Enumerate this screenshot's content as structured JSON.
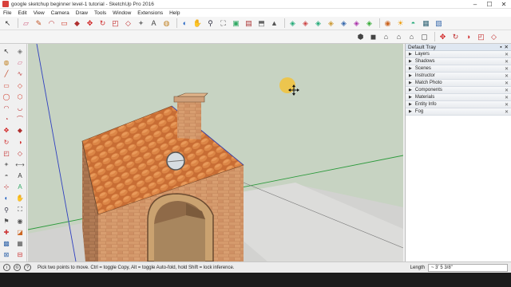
{
  "window": {
    "title": "google sketchup beginner level-1  tutorial - SketchUp Pro 2016",
    "minimize": "–",
    "maximize": "☐",
    "close": "✕"
  },
  "menu": [
    "File",
    "Edit",
    "View",
    "Camera",
    "Draw",
    "Tools",
    "Window",
    "Extensions",
    "Help"
  ],
  "toolbar_main": [
    {
      "name": "select-icon",
      "glyph": "↖",
      "color": "#333"
    },
    {
      "name": "eraser-icon",
      "glyph": "▱",
      "color": "#d06080"
    },
    {
      "name": "pencil-icon",
      "glyph": "✎",
      "color": "#c05020"
    },
    {
      "name": "arc-icon",
      "glyph": "◠",
      "color": "#c04040"
    },
    {
      "name": "shape-icon",
      "glyph": "▭",
      "color": "#d04030"
    },
    {
      "name": "pushpull-icon",
      "glyph": "◆",
      "color": "#b03030"
    },
    {
      "name": "move-icon",
      "glyph": "✥",
      "color": "#d02020"
    },
    {
      "name": "rotate-icon",
      "glyph": "↻",
      "color": "#d03030"
    },
    {
      "name": "scale-icon",
      "glyph": "◰",
      "color": "#c02020"
    },
    {
      "name": "offset-icon",
      "glyph": "◇",
      "color": "#c03030"
    },
    {
      "name": "tape-icon",
      "glyph": "✦",
      "color": "#777"
    },
    {
      "name": "text-icon",
      "glyph": "A",
      "color": "#444"
    },
    {
      "name": "paint-icon",
      "glyph": "◍",
      "color": "#c08020"
    },
    {
      "name": "orbit-icon",
      "glyph": "◐",
      "color": "#2060c0"
    },
    {
      "name": "pan-icon",
      "glyph": "✋",
      "color": "#aa7744"
    },
    {
      "name": "zoom-icon",
      "glyph": "⚲",
      "color": "#334"
    },
    {
      "name": "zoom-extents-icon",
      "glyph": "⛶",
      "color": "#333"
    },
    {
      "name": "warehouse-icon",
      "glyph": "▣",
      "color": "#3a6"
    },
    {
      "name": "extension-icon",
      "glyph": "▤",
      "color": "#a33"
    },
    {
      "name": "share-icon",
      "glyph": "⬒",
      "color": "#666"
    },
    {
      "name": "send-icon",
      "glyph": "▲",
      "color": "#555"
    },
    {
      "name": "sandbox1-icon",
      "glyph": "◈",
      "color": "#2a7"
    },
    {
      "name": "sandbox2-icon",
      "glyph": "◈",
      "color": "#c44"
    },
    {
      "name": "sandbox3-icon",
      "glyph": "◈",
      "color": "#2a7"
    },
    {
      "name": "sandbox4-icon",
      "glyph": "◈",
      "color": "#c93"
    },
    {
      "name": "sandbox5-icon",
      "glyph": "◈",
      "color": "#36a"
    },
    {
      "name": "sandbox6-icon",
      "glyph": "◈",
      "color": "#a3a"
    },
    {
      "name": "sandbox7-icon",
      "glyph": "◈",
      "color": "#3a3"
    },
    {
      "name": "section-icon",
      "glyph": "◉",
      "color": "#c62"
    },
    {
      "name": "shadow-icon",
      "glyph": "☀",
      "color": "#e90"
    },
    {
      "name": "fog-icon",
      "glyph": "◓",
      "color": "#2a7"
    },
    {
      "name": "layer-icon",
      "glyph": "▦",
      "color": "#367"
    },
    {
      "name": "outliner-icon",
      "glyph": "▧",
      "color": "#36a"
    }
  ],
  "toolbar_views": [
    {
      "name": "iso-view-icon",
      "glyph": "⬢",
      "color": "#444"
    },
    {
      "name": "top-view-icon",
      "glyph": "◼",
      "color": "#444"
    },
    {
      "name": "front-view-icon",
      "glyph": "⌂",
      "color": "#444"
    },
    {
      "name": "right-view-icon",
      "glyph": "⌂",
      "color": "#444"
    },
    {
      "name": "back-view-icon",
      "glyph": "⌂",
      "color": "#444"
    },
    {
      "name": "left-view-icon",
      "glyph": "▢",
      "color": "#444"
    },
    {
      "name": "move-tool-icon",
      "glyph": "✥",
      "color": "#d02020"
    },
    {
      "name": "rotate-tool-icon",
      "glyph": "↻",
      "color": "#c03030"
    },
    {
      "name": "follow-me-icon",
      "glyph": "◑",
      "color": "#d03030"
    },
    {
      "name": "scale-tool-icon",
      "glyph": "◰",
      "color": "#c02020"
    },
    {
      "name": "offset-tool-icon",
      "glyph": "◇",
      "color": "#c03030"
    }
  ],
  "left_tools": [
    {
      "name": "select-tool-icon",
      "glyph": "↖",
      "color": "#222"
    },
    {
      "name": "make-component-icon",
      "glyph": "◈",
      "color": "#777"
    },
    {
      "name": "paint-bucket-icon",
      "glyph": "◍",
      "color": "#c08020"
    },
    {
      "name": "eraser-tool-icon",
      "glyph": "▱",
      "color": "#d06080"
    },
    {
      "name": "line-tool-icon",
      "glyph": "╱",
      "color": "#c04020"
    },
    {
      "name": "freehand-icon",
      "glyph": "∿",
      "color": "#c04040"
    },
    {
      "name": "rectangle-icon",
      "glyph": "▭",
      "color": "#d04030"
    },
    {
      "name": "rotated-rect-icon",
      "glyph": "◇",
      "color": "#d04030"
    },
    {
      "name": "circle-icon",
      "glyph": "◯",
      "color": "#d04030"
    },
    {
      "name": "polygon-icon",
      "glyph": "⬡",
      "color": "#d04030"
    },
    {
      "name": "arc1-icon",
      "glyph": "◠",
      "color": "#c04040"
    },
    {
      "name": "arc2-icon",
      "glyph": "◡",
      "color": "#c04040"
    },
    {
      "name": "pie-icon",
      "glyph": "◔",
      "color": "#c04040"
    },
    {
      "name": "arc3-icon",
      "glyph": "⌒",
      "color": "#c04040"
    },
    {
      "name": "move-left-icon",
      "glyph": "✥",
      "color": "#d02020"
    },
    {
      "name": "pushpull-left-icon",
      "glyph": "◆",
      "color": "#b03030"
    },
    {
      "name": "rotate-left-icon",
      "glyph": "↻",
      "color": "#d03030"
    },
    {
      "name": "followme-left-icon",
      "glyph": "◑",
      "color": "#d03030"
    },
    {
      "name": "scale-left-icon",
      "glyph": "◰",
      "color": "#c02020"
    },
    {
      "name": "offset-left-icon",
      "glyph": "◇",
      "color": "#c03030"
    },
    {
      "name": "tape-left-icon",
      "glyph": "✦",
      "color": "#777"
    },
    {
      "name": "dimension-icon",
      "glyph": "⟷",
      "color": "#555"
    },
    {
      "name": "protractor-icon",
      "glyph": "◓",
      "color": "#777"
    },
    {
      "name": "text-left-icon",
      "glyph": "A",
      "color": "#333"
    },
    {
      "name": "axes-icon",
      "glyph": "⊹",
      "color": "#c03030"
    },
    {
      "name": "3dtext-icon",
      "glyph": "A",
      "color": "#3a6"
    },
    {
      "name": "orbit-left-icon",
      "glyph": "◐",
      "color": "#2060c0"
    },
    {
      "name": "pan-left-icon",
      "glyph": "✋",
      "color": "#aa7744"
    },
    {
      "name": "zoom-left-icon",
      "glyph": "⚲",
      "color": "#334"
    },
    {
      "name": "zoom-window-icon",
      "glyph": "⛶",
      "color": "#333"
    },
    {
      "name": "walk-icon",
      "glyph": "⚑",
      "color": "#555"
    },
    {
      "name": "look-around-icon",
      "glyph": "◉",
      "color": "#555"
    },
    {
      "name": "position-camera-icon",
      "glyph": "✚",
      "color": "#c33"
    },
    {
      "name": "section-left-icon",
      "glyph": "◪",
      "color": "#c62"
    },
    {
      "name": "xray-icon",
      "glyph": "▩",
      "color": "#36a"
    },
    {
      "name": "hidden-line-icon",
      "glyph": "▦",
      "color": "#555"
    },
    {
      "name": "wireframe-icon",
      "glyph": "⊠",
      "color": "#36a"
    },
    {
      "name": "shaded-icon",
      "glyph": "⊟",
      "color": "#c33"
    }
  ],
  "tray": {
    "title": "Default Tray",
    "sections": [
      "Layers",
      "Shadows",
      "Scenes",
      "Instructor",
      "Match Photo",
      "Components",
      "Materials",
      "Entity Info",
      "Fog"
    ]
  },
  "status": {
    "hint": "Pick two points to move.  Ctrl = toggle Copy, Alt = toggle Auto-fold, hold Shift = lock inference.",
    "measurement_label": "Length",
    "measurement_value": "~ 3' 5 3/8\""
  },
  "colors": {
    "sky": "#c7d3c2",
    "ground": "#d4d4d4",
    "brick": "#c68a5e",
    "roof_tile": "#d47a3e",
    "sun": "#f0c030",
    "axis_green": "#2c9a3c",
    "axis_blue": "#3040c0"
  }
}
